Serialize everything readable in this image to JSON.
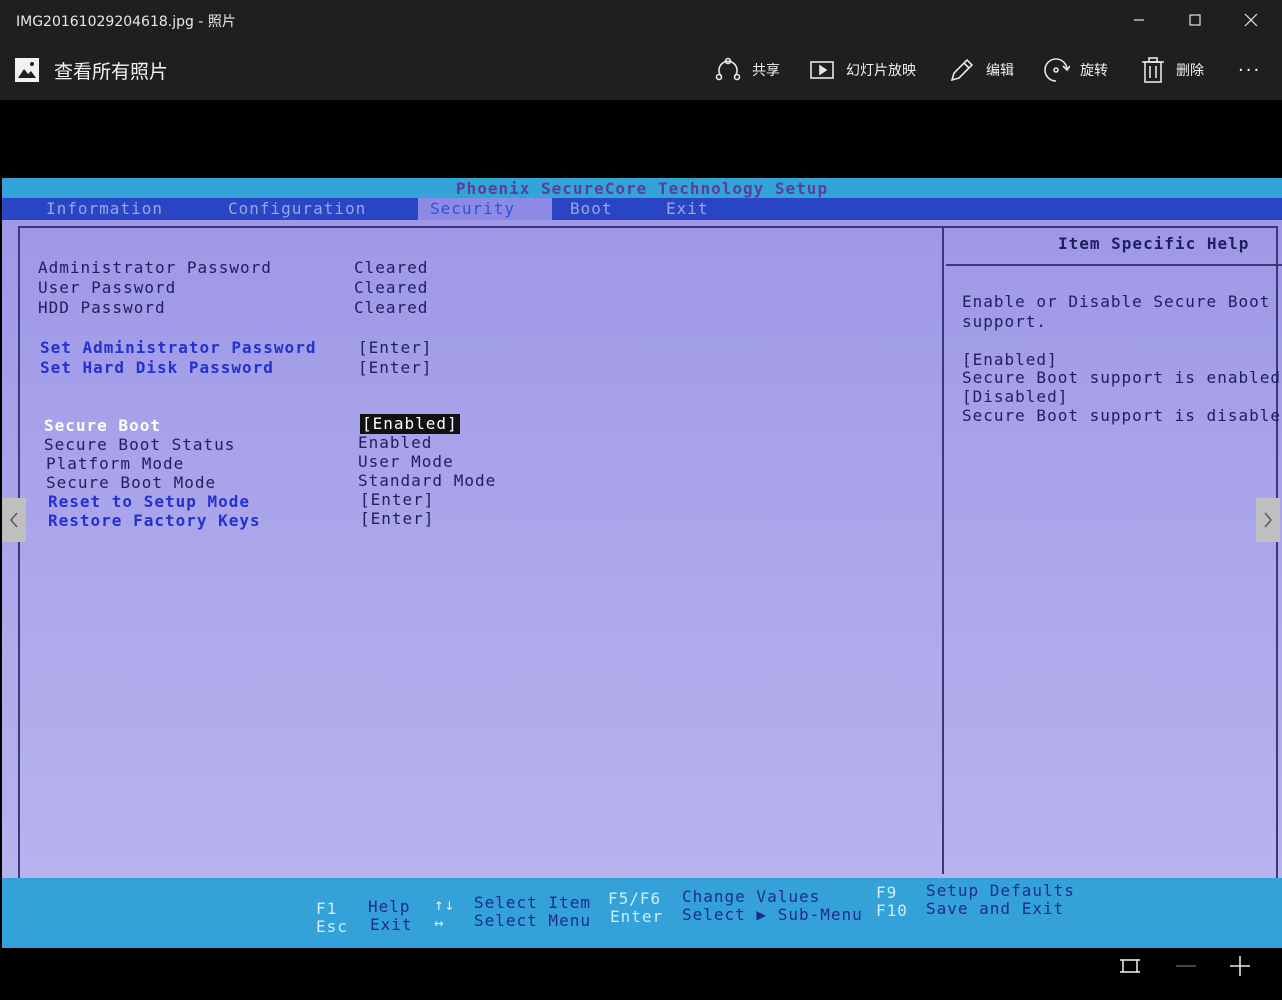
{
  "window": {
    "title": "IMG20161029204618.jpg - 照片"
  },
  "appbar": {
    "back_label": "查看所有照片",
    "actions": [
      {
        "label": "共享",
        "icon": "share-icon"
      },
      {
        "label": "幻灯片放映",
        "icon": "slideshow-icon"
      },
      {
        "label": "编辑",
        "icon": "edit-icon"
      },
      {
        "label": "旋转",
        "icon": "rotate-icon"
      },
      {
        "label": "删除",
        "icon": "delete-icon"
      }
    ],
    "more_label": "···"
  },
  "bios": {
    "title": "Phoenix SecureCore Technology Setup",
    "menus": [
      "Information",
      "Configuration",
      "Security",
      "Boot",
      "Exit"
    ],
    "active_menu": "Security",
    "rows": [
      {
        "label": "Administrator Password",
        "value": "Cleared"
      },
      {
        "label": "User Password",
        "value": "Cleared"
      },
      {
        "label": "HDD Password",
        "value": "Cleared"
      },
      {
        "label": "Set Administrator Password",
        "value": "[Enter]"
      },
      {
        "label": "Set Hard Disk Password",
        "value": "[Enter]"
      },
      {
        "label": "Secure Boot",
        "value": "[Enabled]"
      },
      {
        "label": "Secure Boot Status",
        "value": "Enabled"
      },
      {
        "label": "Platform Mode",
        "value": "User Mode"
      },
      {
        "label": "Secure Boot Mode",
        "value": "Standard Mode"
      },
      {
        "label": "Reset to Setup Mode",
        "value": "[Enter]"
      },
      {
        "label": "Restore Factory Keys",
        "value": "[Enter]"
      }
    ],
    "help": {
      "title": "Item Specific Help",
      "lines": [
        "Enable or Disable Secure Boot",
        "support.",
        "[Enabled]",
        "Secure Boot support is enabled.",
        "[Disabled]",
        "Secure Boot support is disabled"
      ]
    },
    "footer": {
      "f1": "F1",
      "help": "Help",
      "esc": "Esc",
      "exit": "Exit",
      "updown": "↑↓",
      "select_item": "Select Item",
      "leftright": "↔",
      "select_menu": "Select Menu",
      "f5f6": "F5/F6",
      "change_values": "Change Values",
      "enter": "Enter",
      "select_submenu": "Select ▶ Sub-Menu",
      "f9": "F9",
      "setup_defaults": "Setup Defaults",
      "f10": "F10",
      "save_exit": "Save and Exit"
    }
  },
  "colors": {
    "chrome": "#1f1f1f",
    "bios_blue": "#2a46c4",
    "bios_cyan": "#34a2d8",
    "bios_screen": "#a9a4ea"
  }
}
